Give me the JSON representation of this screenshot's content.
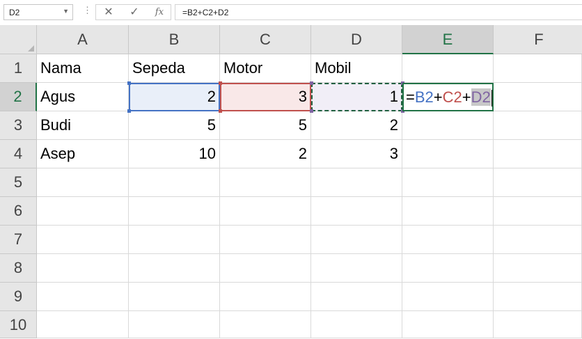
{
  "formula_bar": {
    "name_box": "D2",
    "more_icon": "vertical-dots",
    "cancel_icon": "✕",
    "enter_icon": "✓",
    "fx_icon": "fx",
    "formula": "=B2+C2+D2"
  },
  "columns": [
    "A",
    "B",
    "C",
    "D",
    "E",
    "F"
  ],
  "rows": [
    "1",
    "2",
    "3",
    "4",
    "5",
    "6",
    "7",
    "8",
    "9",
    "10"
  ],
  "cells": {
    "A1": "Nama",
    "B1": "Sepeda",
    "C1": "Motor",
    "D1": "Mobil",
    "A2": "Agus",
    "B2": "2",
    "C2": "3",
    "D2": "1",
    "A3": "Budi",
    "B3": "5",
    "C3": "5",
    "D3": "2",
    "A4": "Asep",
    "B4": "10",
    "C4": "2",
    "D4": "3"
  },
  "editing_cell": {
    "eq": "=",
    "ref_b": "B2",
    "plus1": "+",
    "ref_c": "C2",
    "plus2": "+",
    "ref_d": "D2"
  },
  "colors": {
    "ref_b": "#4472c4",
    "ref_c": "#c0504d",
    "ref_d": "#8064a2",
    "accent": "#217346"
  }
}
